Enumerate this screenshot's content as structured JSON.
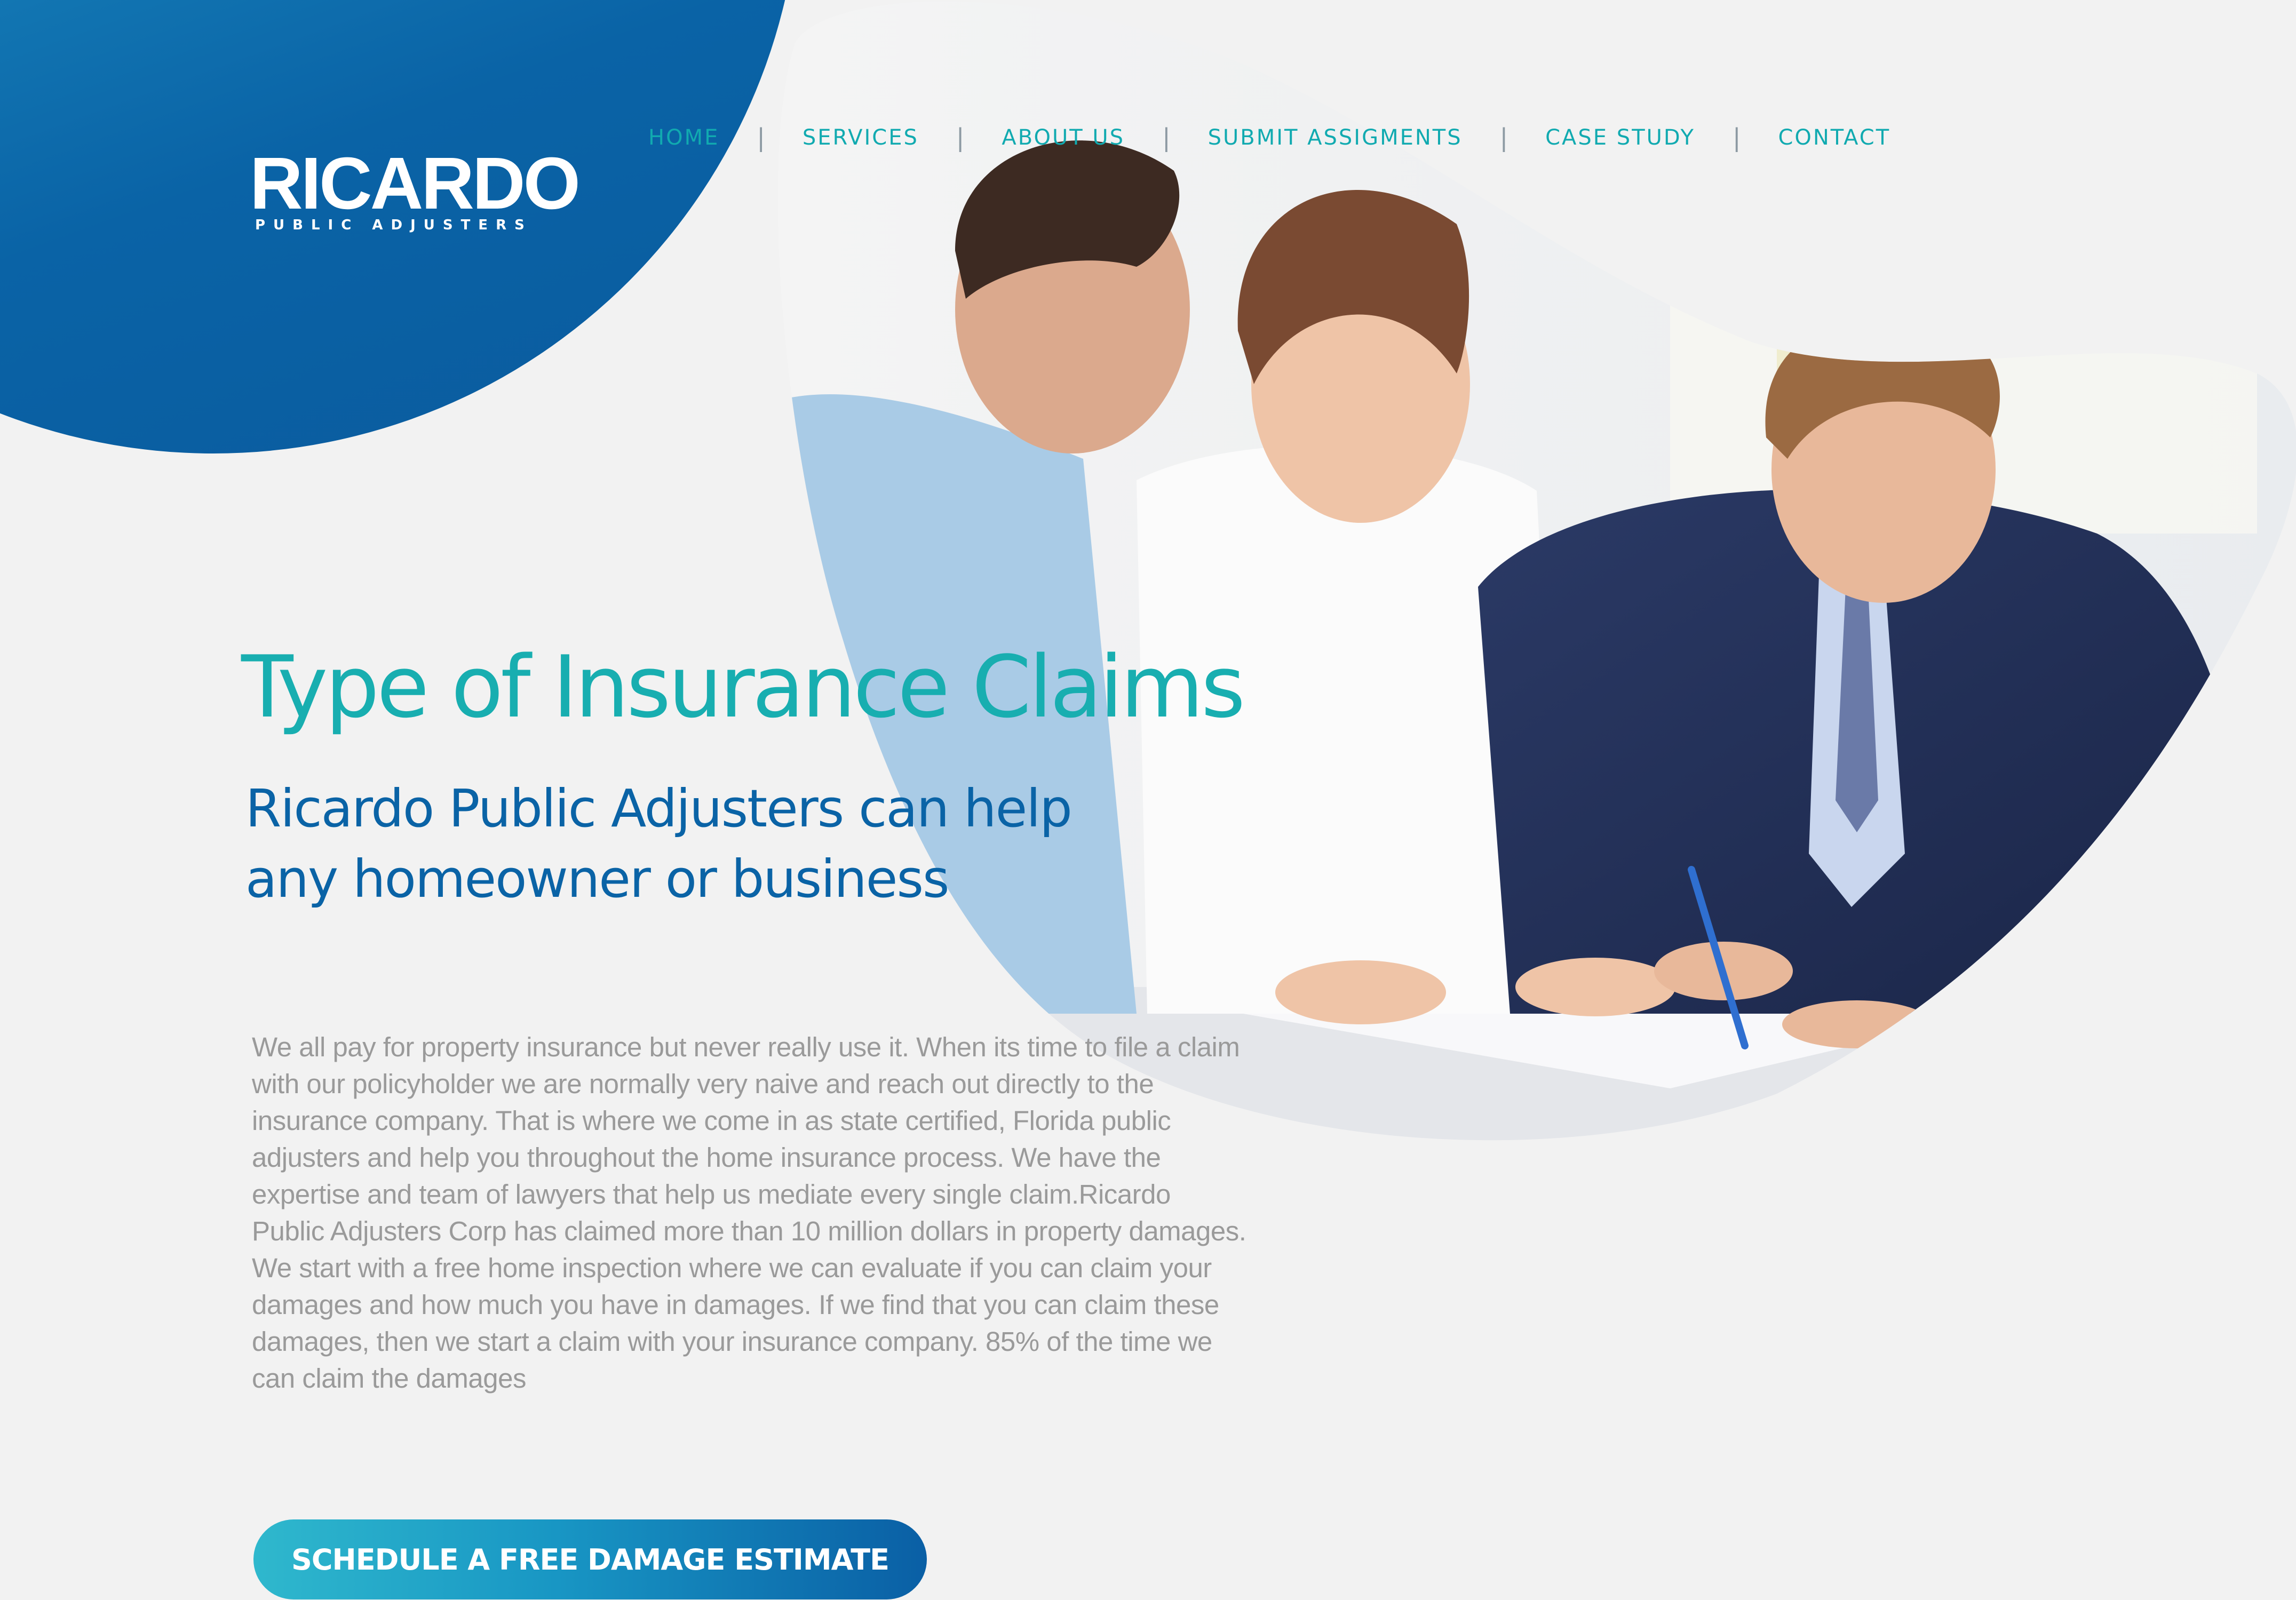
{
  "brand": {
    "name": "RICARDO",
    "tagline": "PUBLIC ADJUSTERS"
  },
  "nav": {
    "items": [
      {
        "label": "HOME",
        "active": true
      },
      {
        "label": "SERVICES"
      },
      {
        "label": "ABOUT US"
      },
      {
        "label": "SUBMIT ASSIGMENTS"
      },
      {
        "label": "CASE STUDY"
      },
      {
        "label": "CONTACT"
      }
    ],
    "separator": "|"
  },
  "hero": {
    "title": "Type of Insurance Claims",
    "subtitle_line1": "Ricardo Public Adjusters can help",
    "subtitle_line2": "any homeowner or business",
    "body": "We all pay for property insurance but never really use it. When its time to file a claim with our policyholder we are normally very naive and reach out directly to the insurance company. That is where we come in as state certified, Florida public adjusters and help you throughout the home insurance process. We have the expertise and team of lawyers that help us mediate every single claim.Ricardo Public Adjusters Corp has claimed more than 10 million dollars in property damages. We start with a free home inspection where we can evaluate if you can claim your damages and how much you have in damages. If we find that you can claim these damages, then we start a claim with your insurance company. 85% of the time we can claim the damages",
    "cta_label": "SCHEDULE A FREE DAMAGE ESTIMATE",
    "photo": "photo of three people reviewing documents"
  },
  "colors": {
    "teal": "#18aeb0",
    "blue": "#0a63a6",
    "background": "#f2f2f2",
    "body_text": "#9a9a9a"
  }
}
